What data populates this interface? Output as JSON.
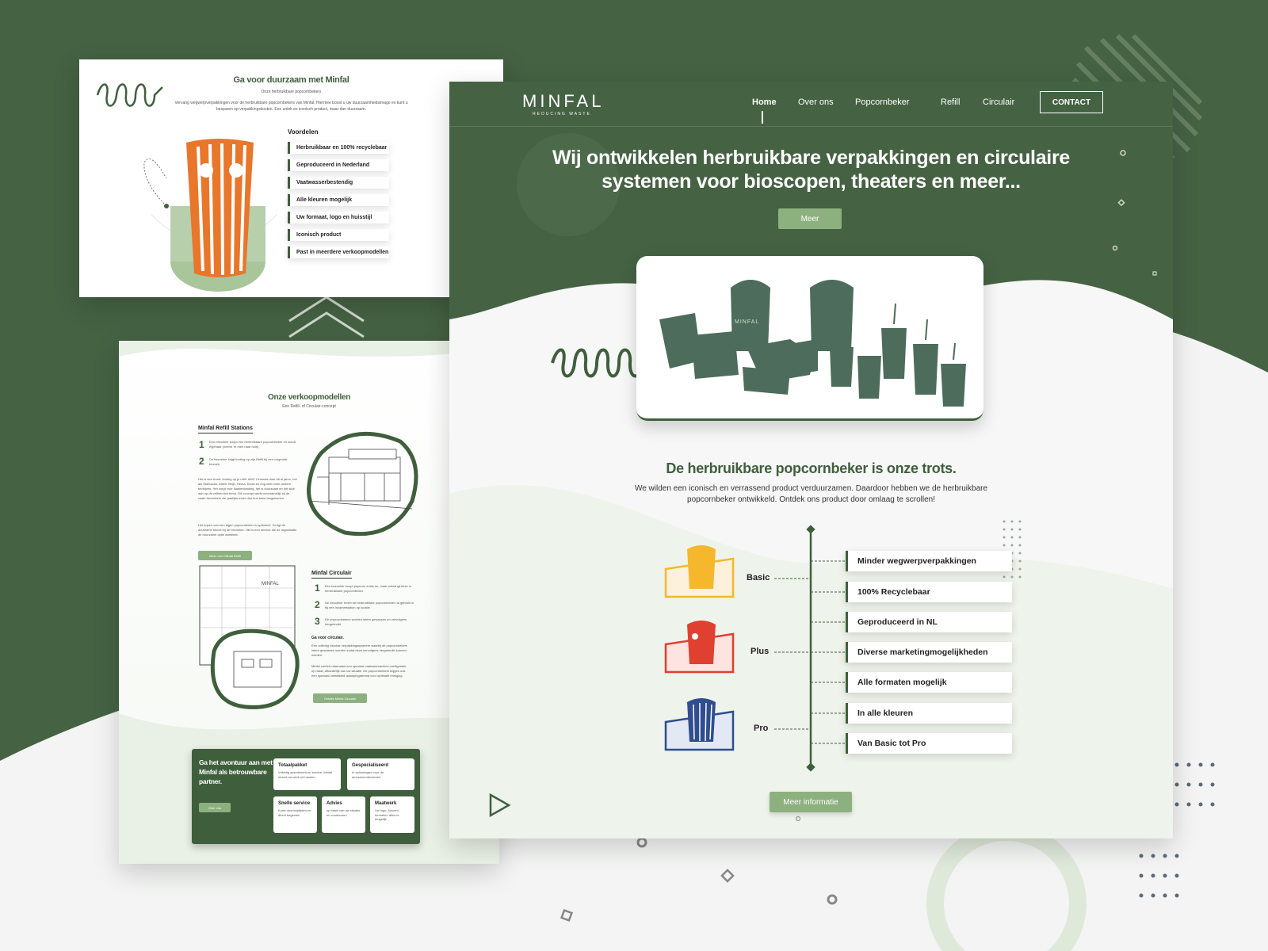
{
  "colors": {
    "brand_green": "#3f5f3c",
    "light_green": "#8db07f",
    "orange": "#e8762b",
    "yellow": "#f5b72c",
    "red": "#e0402f",
    "blue": "#2f4d8f"
  },
  "panel1": {
    "title": "Ga voor duurzaam met Minfal",
    "subtitle": "Onze herbruikbare popcornbekers",
    "intro": "Vervang wegwerpverpakkingen voor de herbruikbare popcornbekers van Minfal. Hiermee boost u uw duurzaamheidsimago en kunt u besparen op verpakkingskosten. Een uniek en iconisch product, maar dan duurzaam.",
    "features_title": "Voordelen",
    "features": [
      "Herbruikbaar en 100% recyclebaar",
      "Geproduceerd in Nederland",
      "Vaatwasserbestendig",
      "Alle kleuren mogelijk",
      "Uw formaat, logo en huisstijl",
      "Iconisch product",
      "Past in meerdere verkoopmodellen"
    ]
  },
  "panel2": {
    "title": "Onze verkoopmodellen",
    "subtitle": "Een Refill- of Circulair-concept",
    "refill_title": "Minfal Refill Stations",
    "refill_steps": [
      "Een bezoeker koopt een herbruikbare popcornbeker en wordt eigenaar (neemt 'm mee naar huis)",
      "De bezoeker krijgt korting op zijn Refill bij een volgende bezoek"
    ],
    "refill_body1": "Het is een trend: korting op je refill. AMC Cinemas doet dit al jaren, net als Starbucks, Albert Heijn, Hema, Kiosk en nog veel meer andere bedrijven. Het zorgt voor klantenbinding, het is duurzaam en het sluit aan op de zelfservice trend. Dit concept werkt voornamelijk bij de vaste bezoekers die jaarlijks meer dan hun twee langskomen.",
    "refill_body2": "Het kopen van een eigen popcornbeker is optioneel. Zo ligt de duurzame keuze bij de bezoeker. Het is een service die de organisatie de duurzame optie aanbiedt.",
    "refill_button": "Meer over Minfal Refill",
    "circ_title": "Minfal Circulair",
    "circ_steps": [
      "Een bezoeker koopt popcorn zoals nu, maar ontvangt deze in herbruikbare popcornbeker",
      "De bezoeker levert de herbruikbare popcornbeker na gebruik in bij een inzamelstation op locatie.",
      "De popcornbekers worden intern gewassen en vervolgens hergebruikt"
    ],
    "circ_sub": "Ga voor circulair.",
    "circ_body1": "Een volledig circulair verpakkingssysteem waarbij de popcornbekers intern gewassen worden zodat deze vervolgens hergebruikt kunnen worden.",
    "circ_body2": "Minfal creëert daarnaast een speciale vaatwasmachine-configuratie op maat, afhankelijk van uw situatie. De popcornbekers krijgen ook een speciaal ontwikkeld waasprogramma voor optimale reiniging.",
    "circ_button": "Ontdek Minfal Circulair",
    "partner_title": "Ga het avontuur aan met Minfal als betrouwbare partner.",
    "partner_button": "Over ons",
    "cards": [
      {
        "h": "Totaalpakket",
        "t": "Volledig assortiment en service, Minfal neemt uw werk uit handen"
      },
      {
        "h": "Gespecialiseerd",
        "t": "In oplossingen voor de amusementensector"
      },
      {
        "h": "Snelle service",
        "t": "Korte doorlooptijden en direct beginnen"
      },
      {
        "h": "Advies",
        "t": "op basis van uw situatie en voorkeuren"
      },
      {
        "h": "Maatwerk",
        "t": "Uw logo, kleuren, formaten: alles is mogelijk"
      }
    ]
  },
  "panel3": {
    "logo": "MINFAL",
    "logo_tagline": "REDUCING WASTE",
    "nav": [
      "Home",
      "Over ons",
      "Popcornbeker",
      "Refill",
      "Circulair"
    ],
    "contact": "CONTACT",
    "hero_line1": "Wij ontwikkelen herbruikbare verpakkingen en circulaire",
    "hero_line2": "systemen voor bioscopen, theaters en meer...",
    "hero_button": "Meer",
    "product_label": "MINFAL",
    "section_title": "De herbruikbare popcornbeker is onze trots.",
    "section_body1": "We wilden een iconisch en verrassend product verduurzamen. Daardoor hebben we de herbruikbare",
    "section_body2": "popcornbeker ontwikkeld. Ontdek ons product door omlaag te scrollen!",
    "tiers": [
      "Basic",
      "Plus",
      "Pro"
    ],
    "benefits": [
      "Minder wegwerpverpakkingen",
      "100% Recyclebaar",
      "Geproduceerd in NL",
      "Diverse marketingmogelijkheden",
      "Alle formaten mogelijk",
      "In alle kleuren",
      "Van Basic tot Pro"
    ],
    "more_button": "Meer informatie"
  }
}
